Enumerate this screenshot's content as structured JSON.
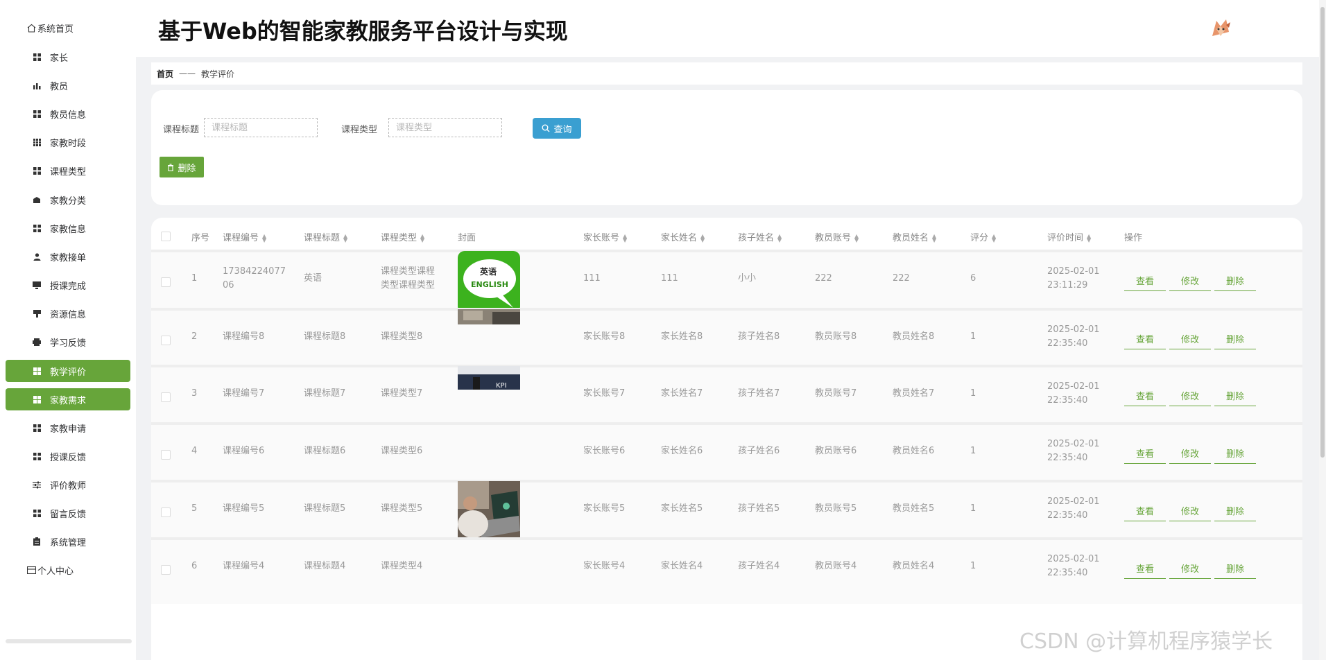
{
  "app": {
    "title": "基于Web的智能家教服务平台设计与实现"
  },
  "sidebar": {
    "items": [
      {
        "label": "系统首页",
        "icon": "home-icon"
      },
      {
        "label": "家长",
        "icon": "grid-icon"
      },
      {
        "label": "教员",
        "icon": "bar-chart-icon"
      },
      {
        "label": "教员信息",
        "icon": "grid-icon"
      },
      {
        "label": "家教时段",
        "icon": "dots-grid-icon"
      },
      {
        "label": "课程类型",
        "icon": "grid-icon"
      },
      {
        "label": "家教分类",
        "icon": "stack-icon"
      },
      {
        "label": "家教信息",
        "icon": "grid-icon"
      },
      {
        "label": "家教接单",
        "icon": "user-icon"
      },
      {
        "label": "授课完成",
        "icon": "monitor-icon"
      },
      {
        "label": "资源信息",
        "icon": "flag-icon"
      },
      {
        "label": "学习反馈",
        "icon": "printer-icon"
      },
      {
        "label": "教学评价",
        "icon": "grid-icon",
        "active": true
      },
      {
        "label": "家教需求",
        "icon": "grid-icon",
        "hover": true
      },
      {
        "label": "家教申请",
        "icon": "grid-icon"
      },
      {
        "label": "授课反馈",
        "icon": "grid-icon"
      },
      {
        "label": "评价教师",
        "icon": "sliders-icon"
      },
      {
        "label": "留言反馈",
        "icon": "grid-icon"
      },
      {
        "label": "系统管理",
        "icon": "clipboard-icon"
      },
      {
        "label": "个人中心",
        "icon": "card-icon"
      }
    ]
  },
  "breadcrumb": {
    "home": "首页",
    "separator": "——",
    "current": "教学评价"
  },
  "search": {
    "title_label": "课程标题",
    "title_placeholder": "课程标题",
    "type_label": "课程类型",
    "type_placeholder": "课程类型",
    "query_button": "查询",
    "delete_button": "删除"
  },
  "table": {
    "headers": [
      "序号",
      "课程编号",
      "课程标题",
      "课程类型",
      "封面",
      "家长账号",
      "家长姓名",
      "孩子姓名",
      "教员账号",
      "教员姓名",
      "评分",
      "评价时间",
      "操作"
    ],
    "sortable": [
      false,
      true,
      true,
      true,
      false,
      true,
      true,
      true,
      true,
      true,
      true,
      true,
      false
    ],
    "actions": {
      "view": "查看",
      "edit": "修改",
      "delete": "删除"
    },
    "rows": [
      {
        "idx": "1",
        "code": "1738422407706",
        "title": "英语",
        "type": "课程类型课程类型课程类型",
        "parent_acc": "111",
        "parent_name": "111",
        "child": "小小",
        "teacher_acc": "222",
        "teacher_name": "222",
        "score": "6",
        "time": "2025-02-01 23:11:29",
        "cover": "english-logo"
      },
      {
        "idx": "2",
        "code": "课程编号8",
        "title": "课程标题8",
        "type": "课程类型8",
        "parent_acc": "家长账号8",
        "parent_name": "家长姓名8",
        "child": "孩子姓名8",
        "teacher_acc": "教员账号8",
        "teacher_name": "教员姓名8",
        "score": "1",
        "time": "2025-02-01 22:35:40",
        "cover": "photo-strip"
      },
      {
        "idx": "3",
        "code": "课程编号7",
        "title": "课程标题7",
        "type": "课程类型7",
        "parent_acc": "家长账号7",
        "parent_name": "家长姓名7",
        "child": "孩子姓名7",
        "teacher_acc": "教员账号7",
        "teacher_name": "教员姓名7",
        "score": "1",
        "time": "2025-02-01 22:35:40",
        "cover": "kpi-photo",
        "cover_text": "KPI"
      },
      {
        "idx": "4",
        "code": "课程编号6",
        "title": "课程标题6",
        "type": "课程类型6",
        "parent_acc": "家长账号6",
        "parent_name": "家长姓名6",
        "child": "孩子姓名6",
        "teacher_acc": "教员账号6",
        "teacher_name": "教员姓名6",
        "score": "1",
        "time": "2025-02-01 22:35:40",
        "cover": "none"
      },
      {
        "idx": "5",
        "code": "课程编号5",
        "title": "课程标题5",
        "type": "课程类型5",
        "parent_acc": "家长账号5",
        "parent_name": "家长姓名5",
        "child": "孩子姓名5",
        "teacher_acc": "教员账号5",
        "teacher_name": "教员姓名5",
        "score": "1",
        "time": "2025-02-01 22:35:40",
        "cover": "laptop-photo"
      },
      {
        "idx": "6",
        "code": "课程编号4",
        "title": "课程标题4",
        "type": "课程类型4",
        "parent_acc": "家长账号4",
        "parent_name": "家长姓名4",
        "child": "孩子姓名4",
        "teacher_acc": "教员账号4",
        "teacher_name": "教员姓名4",
        "score": "1",
        "time": "2025-02-01 22:35:40",
        "cover": "none"
      }
    ]
  },
  "cover_logo": {
    "line1": "英语",
    "line2": "ENGLISH"
  },
  "watermark": "CSDN @计算机程序猿学长",
  "colors": {
    "accent": "#67a53a",
    "query": "#3a9fd1"
  }
}
